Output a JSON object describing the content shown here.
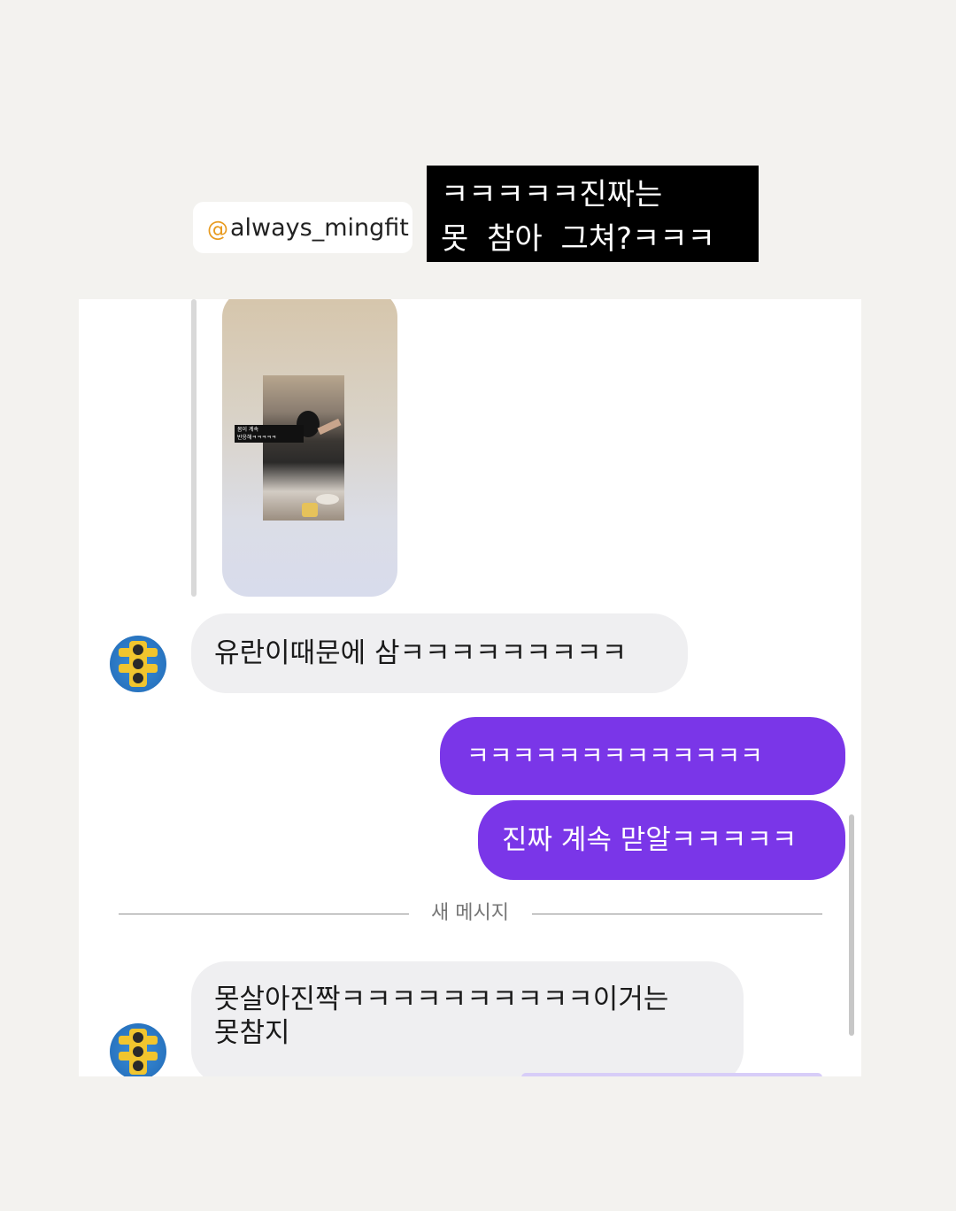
{
  "story_overlay": {
    "mention": "always_mingfit",
    "caption_line1": "ㅋㅋㅋㅋㅋ진짜는",
    "caption_line2": "못 참아 그쳐?ㅋㅋㅋ"
  },
  "chat": {
    "story_reply": {
      "subtitle_line1": "몸이 계속",
      "subtitle_line2": "반응해ㅋㅋㅋㅋㅋ"
    },
    "messages": [
      {
        "from": "other",
        "text": "유란이때문에 삼ㅋㅋㅋㅋㅋㅋㅋㅋㅋ"
      },
      {
        "from": "me",
        "text": "ㅋㅋㅋㅋㅋㅋㅋㅋㅋㅋㅋㅋㅋ"
      },
      {
        "from": "me",
        "text": "진짜 계속 맏알ㅋㅋㅋㅋㅋ"
      },
      {
        "from": "other",
        "text_line1": "못살아진짝ㅋㅋㅋㅋㅋㅋㅋㅋㅋㅋ이거는",
        "text_line2": "못참지"
      }
    ],
    "separator_label": "새 메시지"
  },
  "colors": {
    "background": "#f3f2ef",
    "outgoing_bubble": "#7a36e8",
    "incoming_bubble": "#efeff1",
    "mention_at": "#e89a1e"
  },
  "icons": {
    "avatar": "traffic-light-avatar-icon",
    "mention": "at-sign-icon"
  }
}
